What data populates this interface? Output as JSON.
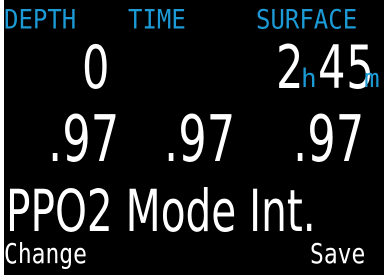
{
  "header": {
    "depth_label": "DEPTH",
    "time_label": "TIME",
    "surface_label": "SURFACE"
  },
  "readings": {
    "depth_value": "0",
    "surface_hours": "2",
    "surface_hours_unit": "h",
    "surface_minutes": "45",
    "surface_minutes_unit": "m"
  },
  "ppo2": {
    "value_1": ".97",
    "value_2": ".97",
    "value_3": ".97"
  },
  "mode_title": "PPO2 Mode Int.",
  "softkeys": {
    "left_label": "Change",
    "right_label": "Save"
  },
  "colors": {
    "background": "#000000",
    "accent": "#1c9ad6",
    "text": "#ffffff"
  }
}
